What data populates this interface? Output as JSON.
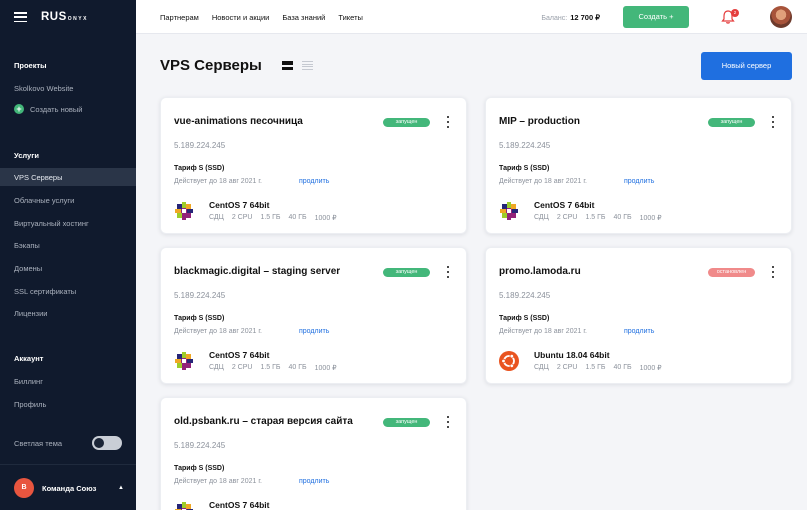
{
  "sidebar": {
    "logo": "RUS",
    "logo_sub": "ONYX",
    "sections": {
      "projects": "Проекты",
      "services": "Услуги",
      "account": "Аккаунт"
    },
    "projects": [
      "Skolkovo Website"
    ],
    "create_new": "Создать новый",
    "services": [
      "VPS Серверы",
      "Облачные услуги",
      "Виртуальный хостинг",
      "Бэкапы",
      "Домены",
      "SSL сертификаты",
      "Лицензии"
    ],
    "account": [
      "Биллинг",
      "Профиль"
    ],
    "theme_label": "Светлая тема",
    "team_initial": "В",
    "team_name": "Команда Союз"
  },
  "topbar": {
    "nav": [
      "Партнерам",
      "Новости и акции",
      "База знаний",
      "Тикеты"
    ],
    "balance_label": "Баланс:",
    "balance_value": "12 700 ₽",
    "create_label": "Создать +",
    "notification_count": "2"
  },
  "page": {
    "title": "VPS Серверы",
    "new_server_label": "Новый сервер"
  },
  "servers": [
    {
      "name": "vue-animations песочница",
      "status": "запущен",
      "ip": "5.189.224.245",
      "tariff": "Тариф S (SSD)",
      "valid": "Действует до 18 авг 2021 г.",
      "extend": "продлить",
      "os": "CentOS 7 64bit",
      "specs": [
        "СДЦ",
        "2 CPU",
        "1.5 ГБ",
        "40 ГБ",
        "1000 ₽"
      ]
    },
    {
      "name": "MIP – production",
      "status": "запущен",
      "ip": "5.189.224.245",
      "tariff": "Тариф S (SSD)",
      "valid": "Действует до 18 авг 2021 г.",
      "extend": "продлить",
      "os": "CentOS 7 64bit",
      "specs": [
        "СДЦ",
        "2 CPU",
        "1.5 ГБ",
        "40 ГБ",
        "1000 ₽"
      ]
    },
    {
      "name": "blackmagic.digital – staging server",
      "status": "запущен",
      "ip": "5.189.224.245",
      "tariff": "Тариф S (SSD)",
      "valid": "Действует до 18 авг 2021 г.",
      "extend": "продлить",
      "os": "CentOS 7 64bit",
      "specs": [
        "СДЦ",
        "2 CPU",
        "1.5 ГБ",
        "40 ГБ",
        "1000 ₽"
      ]
    },
    {
      "name": "promo.lamoda.ru",
      "status": "остановлен",
      "ip": "5.189.224.245",
      "tariff": "Тариф S (SSD)",
      "valid": "Действует до 18 авг 2021 г.",
      "extend": "продлить",
      "os": "Ubuntu 18.04 64bit",
      "specs": [
        "СДЦ",
        "2 CPU",
        "1.5 ГБ",
        "40 ГБ",
        "1000 ₽"
      ]
    },
    {
      "name": "old.psbank.ru – старая версия сайта",
      "status": "запущен",
      "ip": "5.189.224.245",
      "tariff": "Тариф S (SSD)",
      "valid": "Действует до 18 авг 2021 г.",
      "extend": "продлить",
      "os": "CentOS 7 64bit",
      "specs": []
    }
  ],
  "colors": {
    "sidebar_bg": "#101a2d",
    "accent_green": "#43b77a",
    "accent_blue": "#1f6fe0",
    "status_stopped": "#f08a8a"
  }
}
